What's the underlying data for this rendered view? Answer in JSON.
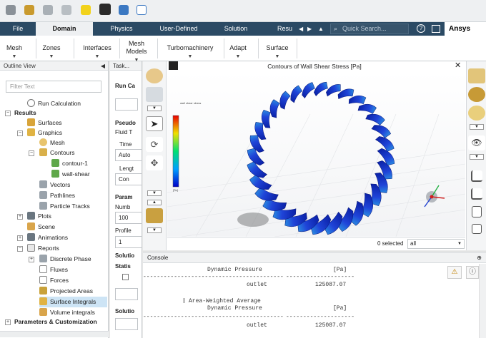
{
  "menubar": {
    "tabs": [
      "File",
      "Domain",
      "Physics",
      "User-Defined",
      "Solution",
      "Resu"
    ],
    "search_placeholder": "Quick Search...",
    "brand": "Ansys"
  },
  "ribbon": {
    "items": [
      [
        "Mesh"
      ],
      [
        "Zones"
      ],
      [
        "Interfaces"
      ],
      [
        "Mesh",
        "Models"
      ],
      [
        "Turbomachinery"
      ],
      [
        "Adapt"
      ],
      [
        "Surface"
      ]
    ]
  },
  "outline": {
    "title": "Outline View",
    "filter_placeholder": "Filter Text",
    "items": [
      "Run Calculation",
      "Results",
      "Surfaces",
      "Graphics",
      "Mesh",
      "Contours",
      "contour-1",
      "wall-shear",
      "Vectors",
      "Pathlines",
      "Particle Tracks",
      "Plots",
      "Scene",
      "Animations",
      "Reports",
      "Discrete Phase",
      "Fluxes",
      "Forces",
      "Projected Areas",
      "Surface Integrals",
      "Volume integrals",
      "Parameters & Customization"
    ]
  },
  "task": {
    "title": "Task...",
    "labels": [
      "Run Ca",
      "Pseudo",
      "Fluid T",
      "Time",
      "Auto",
      "Lengt",
      "Con",
      "Param",
      "Numb",
      "100",
      "Profile",
      "1",
      "Solutio",
      "Statis",
      "Solutio"
    ]
  },
  "graphics": {
    "title": "Contours of Wall Shear Stress [Pa]",
    "legend_title": "wall shear stress",
    "legend_unit": "[Pa]",
    "selected_text": "0 selected",
    "filter_value": "all"
  },
  "console": {
    "title": "Console",
    "lines": [
      {
        "label": "Dynamic Pressure",
        "value": "[Pa]"
      },
      {
        "label": "-----------------------------------------",
        "value": "--------------------"
      },
      {
        "label": "outlet",
        "value": "125087.07"
      },
      {
        "label": "Area-Weighted Average",
        "value": ""
      },
      {
        "label": "Dynamic Pressure",
        "value": "[Pa]"
      },
      {
        "label": "-----------------------------------------",
        "value": "--------------------"
      },
      {
        "label": "outlet",
        "value": "125087.07"
      }
    ]
  },
  "colors": {
    "menubar": "#2b4a64",
    "selection": "#cde4f5",
    "blade": "#1a3cc8"
  }
}
